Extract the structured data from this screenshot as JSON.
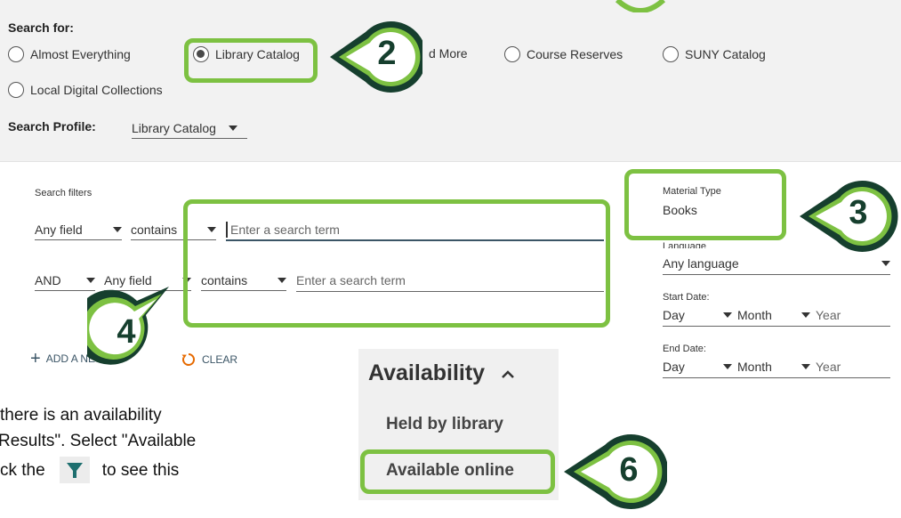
{
  "search_scope": {
    "label": "Search for:",
    "options": [
      {
        "label": "Almost Everything",
        "selected": false
      },
      {
        "label": "Library Catalog",
        "selected": true
      },
      {
        "label": "d More",
        "selected": false
      },
      {
        "label": "Course Reserves",
        "selected": false
      },
      {
        "label": "SUNY Catalog",
        "selected": false
      },
      {
        "label": "Local Digital Collections",
        "selected": false
      }
    ],
    "profile_label": "Search Profile:",
    "profile_value": "Library Catalog"
  },
  "filters": {
    "label": "Search filters",
    "row1": {
      "field": "Any field",
      "operator": "contains",
      "placeholder": "Enter a search term"
    },
    "row2": {
      "boolean": "AND",
      "field": "Any field",
      "operator": "contains",
      "placeholder": "Enter a search term"
    },
    "add_new_label": "ADD A NE",
    "clear_label": "CLEAR"
  },
  "side_filters": {
    "material_type_label": "Material Type",
    "material_type_value": "Books",
    "language_label": "Language",
    "language_value": "Any language",
    "start_date_label": "Start Date:",
    "end_date_label": "End Date:",
    "day": "Day",
    "month": "Month",
    "year": "Year"
  },
  "availability": {
    "title": "Availability",
    "held_by_library": "Held by library",
    "available_online": "Available online"
  },
  "note": {
    "line1": "there is an availability",
    "line2": "Results\". Select \"Available",
    "line3_a": "ck the",
    "line3_b": "to see this"
  },
  "callouts": {
    "c2": "2",
    "c3": "3",
    "c4": "4",
    "c6": "6"
  },
  "colors": {
    "callout_green": "#7dc142",
    "callout_dark": "#163f2e",
    "filter_icon": "#1e6f6f"
  }
}
